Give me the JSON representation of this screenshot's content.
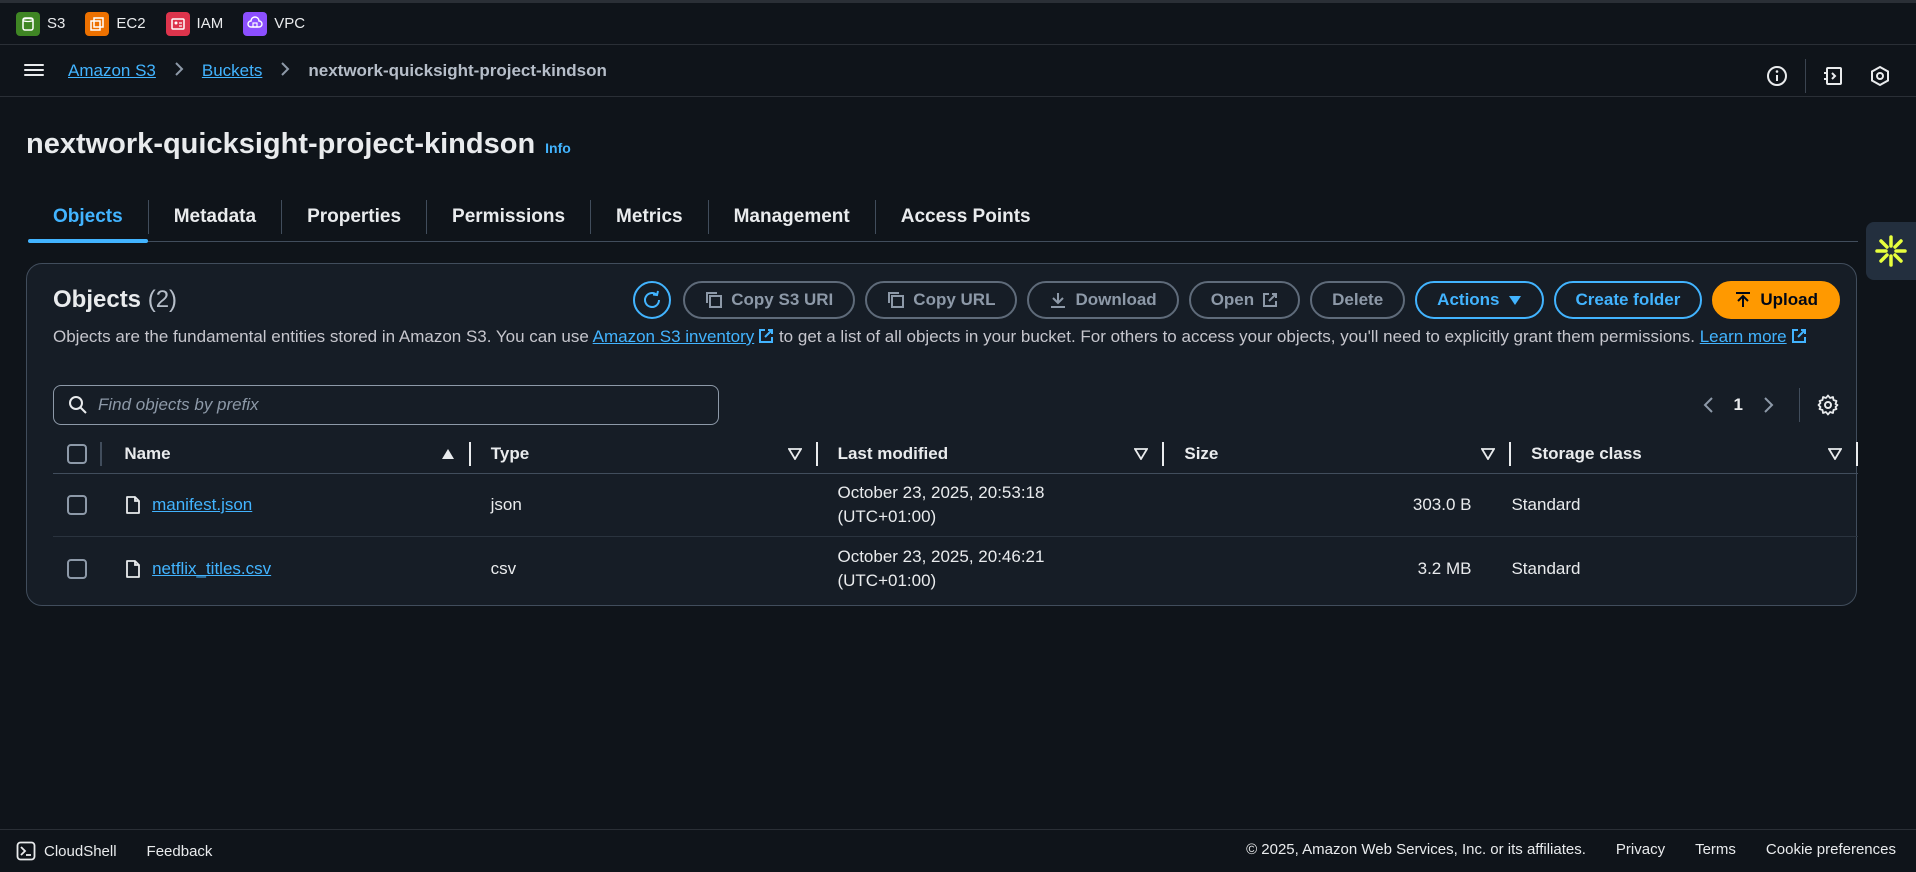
{
  "favorites": [
    {
      "label": "S3",
      "icon": "s3-icon",
      "color": "#3f8624"
    },
    {
      "label": "EC2",
      "icon": "ec2-icon",
      "color": "#ed7100"
    },
    {
      "label": "IAM",
      "icon": "iam-icon",
      "color": "#dd344c"
    },
    {
      "label": "VPC",
      "icon": "vpc-icon",
      "color": "#8c4fff"
    }
  ],
  "breadcrumb": {
    "items": [
      "Amazon S3",
      "Buckets"
    ],
    "current": "nextwork-quicksight-project-kindson"
  },
  "page": {
    "title": "nextwork-quicksight-project-kindson",
    "info_label": "Info"
  },
  "tabs": [
    "Objects",
    "Metadata",
    "Properties",
    "Permissions",
    "Metrics",
    "Management",
    "Access Points"
  ],
  "objects_panel": {
    "title": "Objects",
    "count": "(2)",
    "buttons": {
      "copy_uri": "Copy S3 URI",
      "copy_url": "Copy URL",
      "download": "Download",
      "open": "Open",
      "delete": "Delete",
      "actions": "Actions",
      "create_folder": "Create folder",
      "upload": "Upload"
    },
    "description_part1": "Objects are the fundamental entities stored in Amazon S3. You can use ",
    "description_link1": "Amazon S3 inventory",
    "description_part2": " to get a list of all objects in your bucket. For others to access your objects, you'll need to explicitly grant them permissions. ",
    "description_link2": "Learn more",
    "search_placeholder": "Find objects by prefix",
    "page_number": "1"
  },
  "table": {
    "columns": [
      "Name",
      "Type",
      "Last modified",
      "Size",
      "Storage class"
    ],
    "rows": [
      {
        "name": "manifest.json",
        "type": "json",
        "modified_line1": "October 23, 2025, 20:53:18",
        "modified_line2": "(UTC+01:00)",
        "size": "303.0 B",
        "storage": "Standard"
      },
      {
        "name": "netflix_titles.csv",
        "type": "csv",
        "modified_line1": "October 23, 2025, 20:46:21",
        "modified_line2": "(UTC+01:00)",
        "size": "3.2 MB",
        "storage": "Standard"
      }
    ]
  },
  "footer": {
    "cloudshell": "CloudShell",
    "feedback": "Feedback",
    "copyright": "© 2025, Amazon Web Services, Inc. or its affiliates.",
    "privacy": "Privacy",
    "terms": "Terms",
    "cookie": "Cookie preferences"
  },
  "colors": {
    "accent": "#42b4ff",
    "primary_button": "#ff9900",
    "background": "#0f141a",
    "panel": "#161d26"
  }
}
